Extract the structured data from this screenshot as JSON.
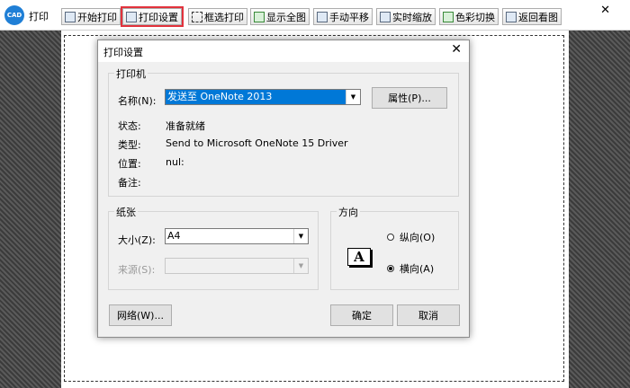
{
  "app": {
    "logo": "CAD",
    "title": "打印"
  },
  "toolbar": {
    "items": [
      {
        "label": "开始打印",
        "icon": "printer-icon"
      },
      {
        "label": "打印设置",
        "icon": "print-settings-icon"
      },
      {
        "label": "框选打印",
        "icon": "box-select-icon"
      },
      {
        "label": "显示全图",
        "icon": "fit-view-icon"
      },
      {
        "label": "手动平移",
        "icon": "pan-icon"
      },
      {
        "label": "实时缩放",
        "icon": "zoom-icon"
      },
      {
        "label": "色彩切换",
        "icon": "color-switch-icon"
      },
      {
        "label": "返回看图",
        "icon": "back-icon"
      }
    ],
    "close": "✕"
  },
  "dialog": {
    "title": "打印设置",
    "close": "✕",
    "printer": {
      "group": "打印机",
      "name_label": "名称(N):",
      "name_value": "发送至 OneNote 2013",
      "properties_btn": "属性(P)...",
      "status_label": "状态:",
      "status_value": "准备就绪",
      "type_label": "类型:",
      "type_value": "Send to Microsoft OneNote 15 Driver",
      "where_label": "位置:",
      "where_value": "nul:",
      "comment_label": "备注:",
      "comment_value": ""
    },
    "paper": {
      "group": "纸张",
      "size_label": "大小(Z):",
      "size_value": "A4",
      "source_label": "来源(S):",
      "source_value": ""
    },
    "orientation": {
      "group": "方向",
      "portrait": "纵向(O)",
      "landscape": "横向(A)",
      "selected": "landscape",
      "icon_letter": "A"
    },
    "network_btn": "网络(W)...",
    "ok_btn": "确定",
    "cancel_btn": "取消"
  },
  "colors": {
    "highlight": "#0078d7",
    "active_outline": "#e2323c",
    "logo": "#1f7fd6"
  }
}
